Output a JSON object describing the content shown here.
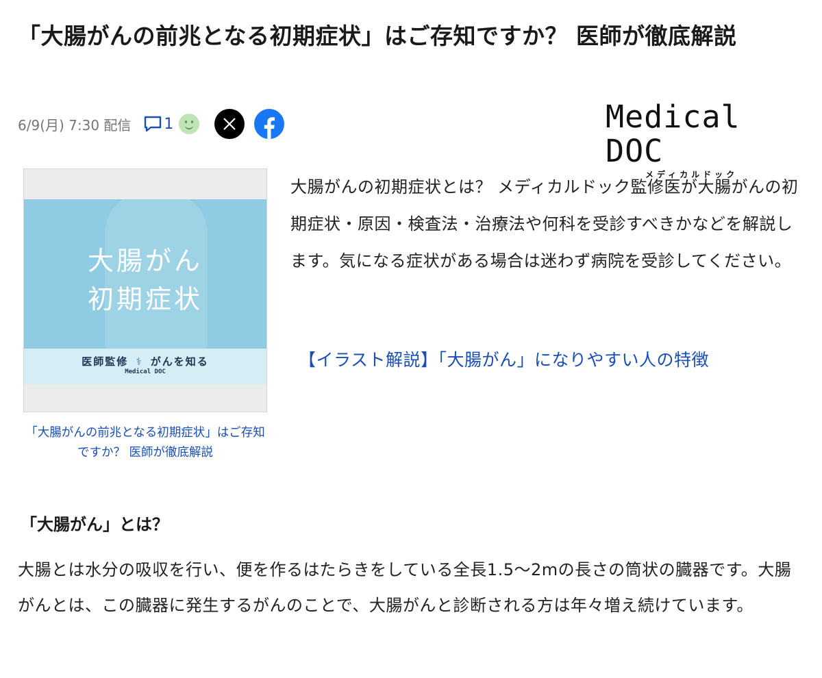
{
  "article": {
    "title": "「大腸がんの前兆となる初期症状」はご存知ですか？ 医師が徹底解説",
    "date": "6/9(月) 7:30 配信",
    "comment_count": "1"
  },
  "share": {
    "x_icon": "x-icon",
    "facebook_icon": "facebook-icon"
  },
  "publisher": {
    "logo_main": "Medical DOC",
    "logo_sub": "メディカルドック"
  },
  "thumbnail": {
    "line1": "大腸がん",
    "line2": "初期症状",
    "band_left": "医師監修",
    "band_right": "がんを知る",
    "band_brand": "Medical DOC",
    "caption": "「大腸がんの前兆となる初期症状」はご存知ですか？ 医師が徹底解説"
  },
  "lead": "大腸がんの初期症状とは？ メディカルドック監修医が大腸がんの初期症状・原因・検査法・治療法や何科を受診すべきかなどを解説します。気になる症状がある場合は迷わず病院を受診してください。",
  "related_link": "【イラスト解説】「大腸がん」になりやすい人の特徴",
  "section": {
    "heading": "「大腸がん」とは？",
    "body": "大腸とは水分の吸収を行い、便を作るはたらきをしている全長1.5〜2mの長さの筒状の臓器です。大腸がんとは、この臓器に発生するがんのことで、大腸がんと診断される方は年々増え続けています。"
  },
  "colors": {
    "link": "#1a4fb8",
    "thumb_bg": "#8fcbe2",
    "facebook": "#1877f2"
  }
}
